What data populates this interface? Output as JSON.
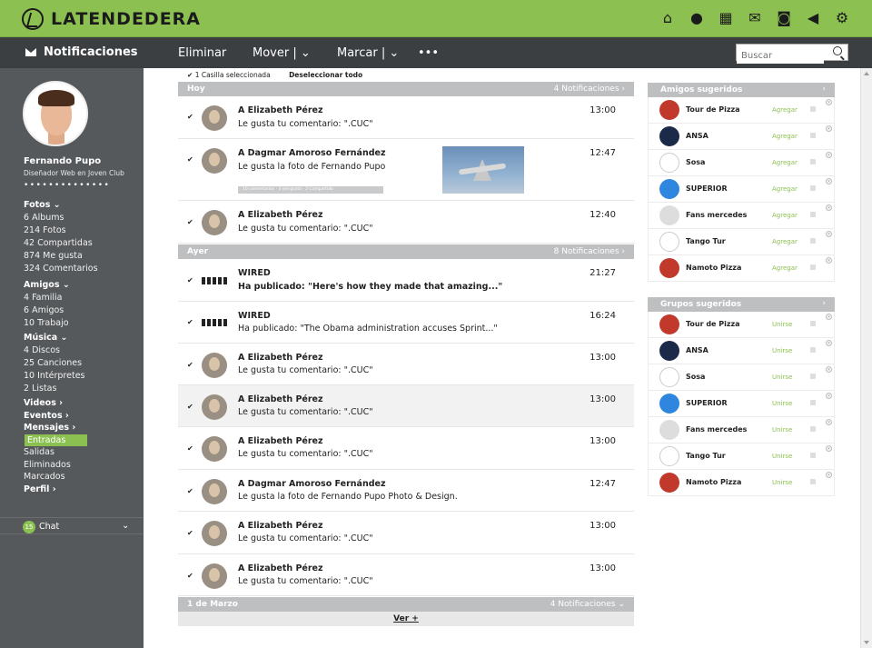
{
  "app": {
    "logo_text": "LATENDEDERA"
  },
  "topbar_icons": [
    "home-icon",
    "user-icon",
    "calendar-icon",
    "mail-icon",
    "camera-icon",
    "volume-icon",
    "gear-icon"
  ],
  "toolbar": {
    "title": "Notificaciones",
    "eliminar": "Eliminar",
    "mover": "Mover |",
    "marcar": "Marcar |",
    "more": "•••",
    "search_placeholder": "Buscar"
  },
  "selection": {
    "count_text": "1 Casilla seleccionada",
    "deselect": "Deseleccionar todo"
  },
  "user": {
    "name": "Fernando Pupo",
    "role": "Diseñador Web en Joven Club",
    "dots": "••••••••••••••"
  },
  "sidebar": {
    "fotos": "Fotos",
    "fotos_items": [
      "6 Albums",
      "214 Fotos",
      "42 Compartidas",
      "874 Me gusta",
      "324 Comentarios"
    ],
    "amigos": "Amigos",
    "amigos_items": [
      "4 Familia",
      "6 Amigos",
      "10 Trabajo"
    ],
    "musica": "Música",
    "musica_items": [
      "4 Discos",
      "25 Canciones",
      "10 Intérpretes",
      "2 Listas"
    ],
    "videos": "Videos ›",
    "eventos": "Eventos ›",
    "mensajes": "Mensajes ›",
    "mensajes_items": [
      "Entradas",
      "Salidas",
      "Eliminados",
      "Marcados"
    ],
    "perfil": "Perfil ›",
    "chat_count": "15",
    "chat_label": "Chat"
  },
  "groups": [
    {
      "name": "Hoy",
      "count": "4 Notificaciones ›"
    },
    {
      "name": "Ayer",
      "count": "8 Notificaciones ›"
    },
    {
      "name": "1 de Marzo",
      "count": "4 Notificaciones ⌄"
    }
  ],
  "notifications": [
    {
      "name": "A Elizabeth Pérez",
      "text": "Le gusta tu comentario: \".CUC\"",
      "time": "13:00"
    },
    {
      "name": "A Dagmar Amoroso Fernández",
      "text": "Le gusta la foto de Fernando Pupo",
      "time": "12:47",
      "stats": "10 comentarios · 3 me gusta · 2 Compartido"
    },
    {
      "name": "A Elizabeth Pérez",
      "text": "Le gusta tu comentario: \".CUC\"",
      "time": "12:40"
    },
    {
      "name": "WIRED",
      "text": "Ha publicado: \"Here's how they made that amazing...\"",
      "time": "21:27"
    },
    {
      "name": "WIRED",
      "text": "Ha publicado: \"The Obama administration accuses Sprint...\"",
      "time": "16:24"
    },
    {
      "name": "A Elizabeth Pérez",
      "text": "Le gusta tu comentario: \".CUC\"",
      "time": "13:00"
    },
    {
      "name": "A Elizabeth Pérez",
      "text": "Le gusta tu comentario: \".CUC\"",
      "time": "13:00"
    },
    {
      "name": "A Elizabeth Pérez",
      "text": "Le gusta tu comentario: \".CUC\"",
      "time": "13:00"
    },
    {
      "name": "A Dagmar Amoroso Fernández",
      "text": "Le gusta la foto de Fernando Pupo Photo & Design.",
      "time": "12:47"
    },
    {
      "name": "A Elizabeth Pérez",
      "text": "Le gusta tu comentario: \".CUC\"",
      "time": "13:00"
    },
    {
      "name": "A Elizabeth Pérez",
      "text": "Le gusta tu comentario: \".CUC\"",
      "time": "13:00"
    }
  ],
  "more": "Ver +",
  "amigos_sugeridos": {
    "title": "Amigos sugeridos",
    "action": "Agregar",
    "items": [
      {
        "name": "Tour de Pizza",
        "color": "#c0392b"
      },
      {
        "name": "ANSA",
        "color": "#1c2a4a"
      },
      {
        "name": "Sosa",
        "color": "#ffffff"
      },
      {
        "name": "SUPERIOR",
        "color": "#2e86de"
      },
      {
        "name": "Fans mercedes",
        "color": "#dddddd"
      },
      {
        "name": "Tango Tur",
        "color": "#ffffff"
      },
      {
        "name": "Namoto Pizza",
        "color": "#c0392b"
      }
    ]
  },
  "grupos_sugeridos": {
    "title": "Grupos sugeridos",
    "action": "Unirse",
    "items": [
      {
        "name": "Tour de Pizza",
        "color": "#c0392b"
      },
      {
        "name": "ANSA",
        "color": "#1c2a4a"
      },
      {
        "name": "Sosa",
        "color": "#ffffff"
      },
      {
        "name": "SUPERIOR",
        "color": "#2e86de"
      },
      {
        "name": "Fans mercedes",
        "color": "#dddddd"
      },
      {
        "name": "Tango Tur",
        "color": "#ffffff"
      },
      {
        "name": "Namoto Pizza",
        "color": "#c0392b"
      }
    ]
  },
  "colors": {
    "accent": "#8cc152",
    "toolbar": "#3b3f42",
    "sidebar": "#56595c"
  }
}
